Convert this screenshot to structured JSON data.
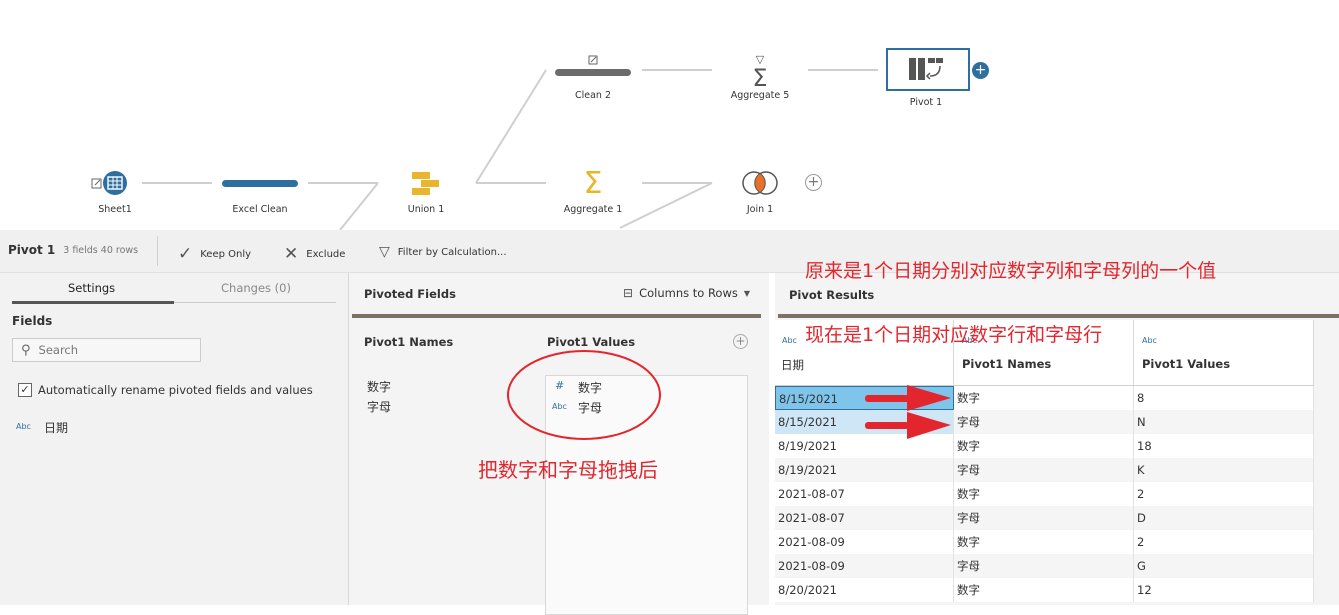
{
  "flow": {
    "nodes": {
      "sheet1": "Sheet1",
      "excel_clean": "Excel Clean",
      "union1": "Union 1",
      "aggregate1": "Aggregate 1",
      "join1": "Join 1",
      "clean2": "Clean 2",
      "aggregate5": "Aggregate 5",
      "pivot1": "Pivot 1"
    }
  },
  "toolbar": {
    "step_name": "Pivot 1",
    "meta": "3 fields  40 rows",
    "keep_only": "Keep Only",
    "exclude": "Exclude",
    "filter": "Filter by Calculation..."
  },
  "settings": {
    "tab_settings": "Settings",
    "tab_changes": "Changes (0)",
    "fields_heading": "Fields",
    "search_placeholder": "Search",
    "auto_rename_label": "Automatically rename pivoted fields and values",
    "field_type": "Abc",
    "field_name": "日期"
  },
  "pivoted": {
    "title": "Pivoted Fields",
    "mode": "Columns to Rows",
    "names_header": "Pivot1 Names",
    "values_header": "Pivot1 Values",
    "names": [
      "数字",
      "字母"
    ],
    "values": [
      {
        "type": "#",
        "name": "数字"
      },
      {
        "type": "Abc",
        "name": "字母"
      }
    ]
  },
  "results": {
    "title": "Pivot Results",
    "columns": [
      {
        "type": "Abc",
        "name": "日期"
      },
      {
        "type": "Abc",
        "name": "Pivot1 Names"
      },
      {
        "type": "Abc",
        "name": "Pivot1 Values"
      }
    ],
    "rows": [
      [
        "8/15/2021",
        "数字",
        "8"
      ],
      [
        "8/15/2021",
        "字母",
        "N"
      ],
      [
        "8/19/2021",
        "数字",
        "18"
      ],
      [
        "8/19/2021",
        "字母",
        "K"
      ],
      [
        "2021-08-07",
        "数字",
        "2"
      ],
      [
        "2021-08-07",
        "字母",
        "D"
      ],
      [
        "2021-08-09",
        "数字",
        "2"
      ],
      [
        "2021-08-09",
        "字母",
        "G"
      ],
      [
        "8/20/2021",
        "数字",
        "12"
      ]
    ]
  },
  "annotations": {
    "before": "原来是1个日期分别对应数字列和字母列的一个值",
    "after": "现在是1个日期对应数字行和字母行",
    "drag": "把数字和字母拖拽后"
  },
  "colors": {
    "annotation": "#e3262e",
    "selected_row": "#7fc4ea",
    "selected_row_light": "#cfe6f6",
    "accent": "#2f6f9f"
  }
}
